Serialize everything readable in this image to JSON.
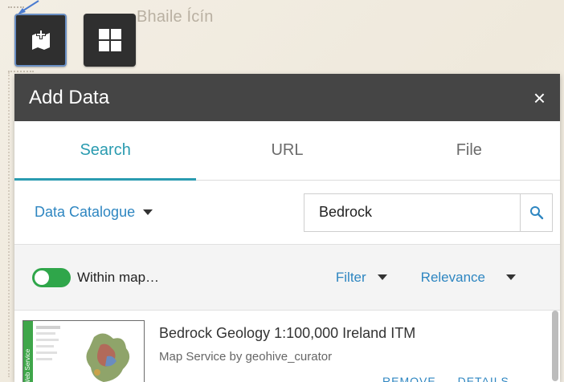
{
  "map": {
    "place_label": "Bhaile Ícín"
  },
  "toolbar": {
    "add_data_icon": "add-data-icon",
    "grid_icon": "grid-icon"
  },
  "panel": {
    "title": "Add Data",
    "close_label": "×",
    "tabs": [
      {
        "label": "Search",
        "active": true
      },
      {
        "label": "URL",
        "active": false
      },
      {
        "label": "File",
        "active": false
      }
    ],
    "catalogue_label": "Data Catalogue",
    "search": {
      "value": "Bedrock",
      "placeholder": ""
    },
    "within_map_label": "Within map…",
    "within_map_enabled": true,
    "filter_label": "Filter",
    "sort_label": "Relevance",
    "results": [
      {
        "title": "Bedrock Geology 1:100,000 Ireland ITM",
        "subtitle": "Map Service by geohive_curator",
        "actions": [
          "REMOVE",
          "DETAILS"
        ],
        "thumb_label": "Web Service"
      }
    ]
  },
  "colors": {
    "accent": "#2a9bb0",
    "link": "#2e86c1",
    "toggle_on": "#2fa64a",
    "header_bg": "#454545"
  }
}
